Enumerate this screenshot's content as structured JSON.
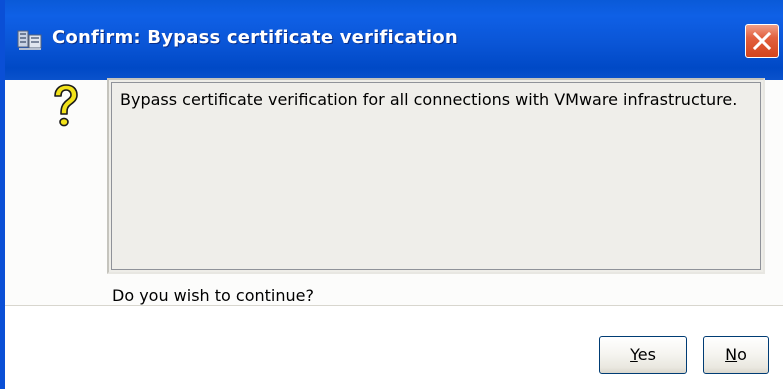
{
  "dialog": {
    "title": "Confirm: Bypass certificate verification",
    "title_icon": "vmware-infrastructure-icon",
    "close_icon": "close-icon",
    "question_icon": "question-mark-icon",
    "message": "Bypass certificate verification for all connections with VMware infrastructure.",
    "prompt": "Do you wish to continue?",
    "buttons": {
      "yes": "Yes",
      "no": "No"
    }
  },
  "colors": {
    "titlebar": "#0a55d6",
    "close_button": "#d4441d",
    "message_background": "#efeeea",
    "question_icon": "#f2e21a"
  }
}
